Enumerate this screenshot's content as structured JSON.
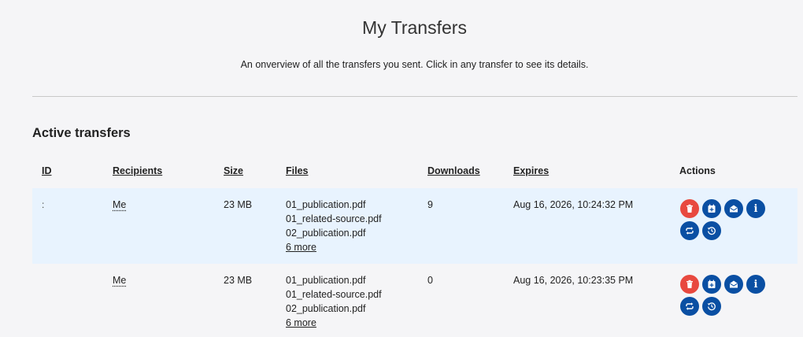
{
  "page": {
    "title": "My Transfers",
    "subtitle": "An onverview of all the transfers you sent. Click in any transfer to see its details."
  },
  "section": {
    "title": "Active transfers"
  },
  "table": {
    "columns": {
      "id": "ID",
      "recipients": "Recipients",
      "size": "Size",
      "files": "Files",
      "downloads": "Downloads",
      "expires": "Expires",
      "actions": "Actions"
    },
    "rows": [
      {
        "id": ":",
        "recipients": "Me",
        "size": "23 MB",
        "files": [
          "01_publication.pdf",
          "01_related-source.pdf",
          "02_publication.pdf"
        ],
        "more": "6 more",
        "downloads": "9",
        "expires": "Aug 16, 2026, 10:24:32 PM"
      },
      {
        "id": "",
        "recipients": "Me",
        "size": "23 MB",
        "files": [
          "01_publication.pdf",
          "01_related-source.pdf",
          "02_publication.pdf"
        ],
        "more": "6 more",
        "downloads": "0",
        "expires": "Aug 16, 2026, 10:23:35 PM"
      }
    ]
  },
  "actions": [
    {
      "icon": "trash-icon",
      "color": "#e8493f"
    },
    {
      "icon": "calendar-add-icon",
      "color": "#0a4fa3"
    },
    {
      "icon": "envelope-open-icon",
      "color": "#0a4fa3"
    },
    {
      "icon": "info-icon",
      "color": "#0a4fa3"
    },
    {
      "icon": "repeat-icon",
      "color": "#0a4fa3"
    },
    {
      "icon": "history-icon",
      "color": "#0a4fa3"
    }
  ],
  "colors": {
    "background": "#f5f5f7",
    "row_highlight": "#e8f3fe",
    "delete": "#e8493f",
    "primary": "#0a4fa3"
  }
}
